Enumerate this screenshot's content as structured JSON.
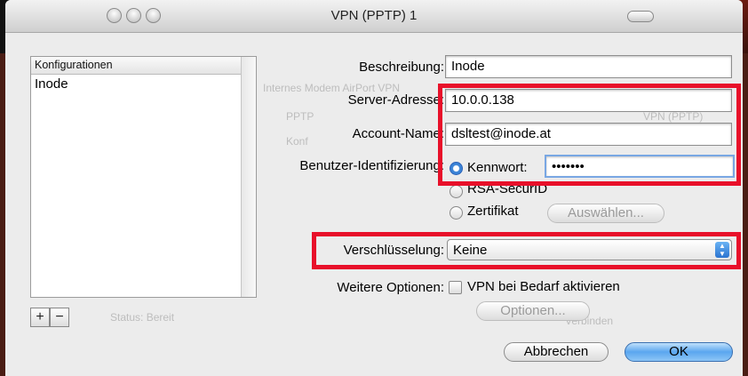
{
  "window": {
    "title": "VPN (PPTP) 1"
  },
  "sidebar": {
    "header": "Konfigurationen",
    "items": [
      {
        "label": "Inode"
      }
    ],
    "add_label": "+",
    "remove_label": "−"
  },
  "form": {
    "description": {
      "label": "Beschreibung:",
      "value": "Inode"
    },
    "server": {
      "label": "Server-Adresse:",
      "value": "10.0.0.138"
    },
    "account": {
      "label": "Account-Name:",
      "value": "dsltest@inode.at"
    },
    "auth": {
      "label": "Benutzer-Identifizierung:",
      "options": [
        {
          "label": "Kennwort:",
          "selected": true
        },
        {
          "label": "RSA-SecurID",
          "selected": false
        },
        {
          "label": "Zertifikat",
          "selected": false
        }
      ],
      "password_value": "•••••••",
      "choose_button": "Auswählen..."
    },
    "encryption": {
      "label": "Verschlüsselung:",
      "value": "Keine"
    },
    "more_options": {
      "label": "Weitere Optionen:",
      "checkbox_label": "VPN bei Bedarf aktivieren",
      "checked": false,
      "options_button": "Optionen..."
    }
  },
  "footer": {
    "cancel_label": "Abbrechen",
    "ok_label": "OK"
  },
  "background_ghost": {
    "tabs": "Internes Modem  AirPort  VPN",
    "status": "Status: Bereit",
    "connect": "Verbinden",
    "pptp": "PPTP",
    "config": "Konf",
    "vpn_badge": "VPN (PPTP)"
  },
  "colors": {
    "highlight": "#e8102a",
    "accent": "#3b83d6",
    "window_bg": "#ececec"
  }
}
